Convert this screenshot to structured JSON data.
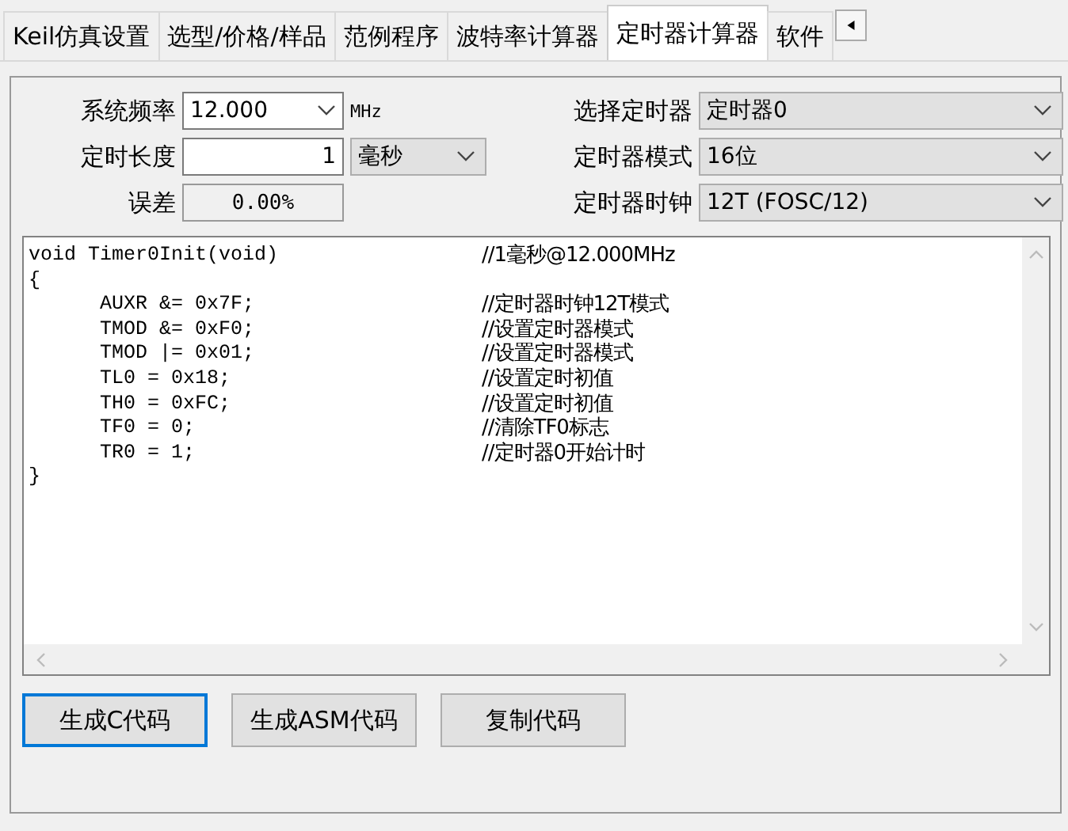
{
  "tabs": [
    {
      "label": "Keil仿真设置",
      "selected": false
    },
    {
      "label": "选型/价格/样品",
      "selected": false
    },
    {
      "label": "范例程序",
      "selected": false
    },
    {
      "label": "波特率计算器",
      "selected": false
    },
    {
      "label": "定时器计算器",
      "selected": true
    },
    {
      "label": "软件",
      "selected": false
    }
  ],
  "form": {
    "left": [
      {
        "kind": "combo",
        "label": "系统频率",
        "value": "12.000",
        "unit": "MHz"
      },
      {
        "kind": "input",
        "label": "定时长度",
        "value": "1",
        "unit": "毫秒"
      },
      {
        "kind": "readonly",
        "label": "误差",
        "value": "0.00%"
      }
    ],
    "right": [
      {
        "label": "选择定时器",
        "value": "定时器0"
      },
      {
        "label": "定时器模式",
        "value": "16位"
      },
      {
        "label": "定时器时钟",
        "value": "12T (FOSC/12)"
      }
    ]
  },
  "code": [
    {
      "code": "void Timer0Init(void)",
      "comment": "//1毫秒@12.000MHz"
    },
    {
      "code": "{"
    },
    {
      "code": "\tAUXR &= 0x7F;",
      "comment": "//定时器时钟12T模式"
    },
    {
      "code": "\tTMOD &= 0xF0;",
      "comment": "//设置定时器模式"
    },
    {
      "code": "\tTMOD |= 0x01;",
      "comment": "//设置定时器模式"
    },
    {
      "code": "\tTL0 = 0x18;",
      "comment": "//设置定时初值"
    },
    {
      "code": "\tTH0 = 0xFC;",
      "comment": "//设置定时初值"
    },
    {
      "code": "\tTF0 = 0;",
      "comment": "//清除TF0标志"
    },
    {
      "code": "\tTR0 = 1;",
      "comment": "//定时器0开始计时"
    },
    {
      "code": "}"
    }
  ],
  "buttons": [
    {
      "label": "生成C代码",
      "focused": true
    },
    {
      "label": "生成ASM代码",
      "focused": false
    },
    {
      "label": "复制代码",
      "focused": false
    }
  ]
}
